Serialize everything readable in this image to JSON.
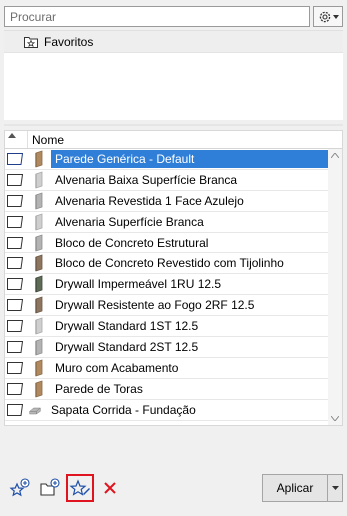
{
  "search": {
    "placeholder": "Procurar",
    "value": ""
  },
  "favorites": {
    "header_label": "Favoritos"
  },
  "list": {
    "column_name": "Nome",
    "items": [
      {
        "label": "Parede Genérica - Default",
        "selected": true,
        "swatch": "brown"
      },
      {
        "label": "Alvenaria Baixa Superfície Branca",
        "swatch": "lightgray"
      },
      {
        "label": "Alvenaria Revestida 1 Face Azulejo",
        "swatch": "gray"
      },
      {
        "label": "Alvenaria Superfície Branca",
        "swatch": "lightgray"
      },
      {
        "label": "Bloco de Concreto Estrutural",
        "swatch": "gray"
      },
      {
        "label": "Bloco de Concreto Revestido com Tijolinho",
        "swatch": "darkbrown"
      },
      {
        "label": "Drywall Impermeável 1RU 12.5",
        "swatch": "darkgreen"
      },
      {
        "label": "Drywall Resistente ao Fogo 2RF 12.5",
        "swatch": "darkbrown"
      },
      {
        "label": "Drywall Standard 1ST 12.5",
        "swatch": "lightgray"
      },
      {
        "label": "Drywall Standard 2ST 12.5",
        "swatch": "gray"
      },
      {
        "label": "Muro com Acabamento",
        "swatch": "brown"
      },
      {
        "label": "Parede de Toras",
        "swatch": "brown"
      },
      {
        "label": "Sapata Corrida - Fundação",
        "swatch": "stone"
      }
    ]
  },
  "footer": {
    "apply_label": "Aplicar"
  },
  "colors": {
    "selection": "#2f7fd8",
    "delete_red": "#e0141e",
    "icon_blue": "#1f4fa8"
  }
}
